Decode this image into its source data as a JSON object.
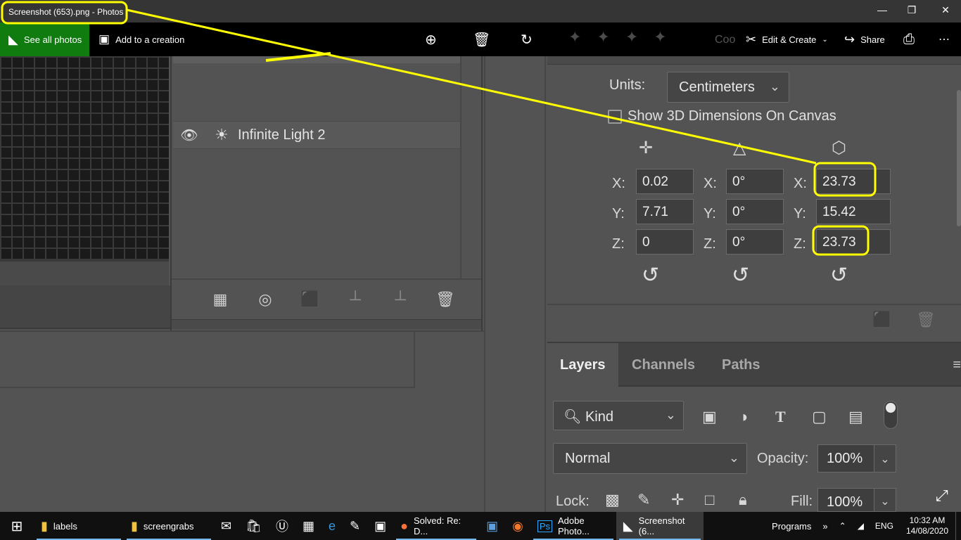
{
  "photos": {
    "window_title": "Screenshot (653).png - Photos",
    "see_all": "See all photos",
    "add_to_creation": "Add to a creation",
    "edit_create": "Edit & Create",
    "share": "Share",
    "faded_label": "Coo"
  },
  "scene": {
    "light_name": "Infinite Light 2"
  },
  "properties": {
    "units_label": "Units:",
    "units_value": "Centimeters",
    "show3d_label": "Show 3D Dimensions On Canvas",
    "position": {
      "x_label": "X:",
      "y_label": "Y:",
      "z_label": "Z:",
      "x": "0.02",
      "y": "7.71",
      "z": "0"
    },
    "rotation": {
      "x_label": "X:",
      "y_label": "Y:",
      "z_label": "Z:",
      "x": "0°",
      "y": "0°",
      "z": "0°"
    },
    "scale": {
      "x_label": "X:",
      "y_label": "Y:",
      "z_label": "Z:",
      "x": "23.73",
      "y": "15.42",
      "z": "23.73"
    }
  },
  "layers": {
    "tabs": [
      "Layers",
      "Channels",
      "Paths"
    ],
    "kind": "Kind",
    "blend_mode": "Normal",
    "opacity_label": "Opacity:",
    "opacity": "100%",
    "lock_label": "Lock:",
    "fill_label": "Fill:",
    "fill": "100%"
  },
  "taskbar": {
    "apps": [
      "labels",
      "screengrabs",
      "Solved: Re: D...",
      "Adobe Photo...",
      "Screenshot (6..."
    ],
    "programs": "Programs",
    "lang": "ENG",
    "time": "10:32 AM",
    "date": "14/08/2020"
  },
  "colors": {
    "annotation": "#ffff00",
    "photos_green": "#107c10",
    "ps_panel": "#535353"
  }
}
